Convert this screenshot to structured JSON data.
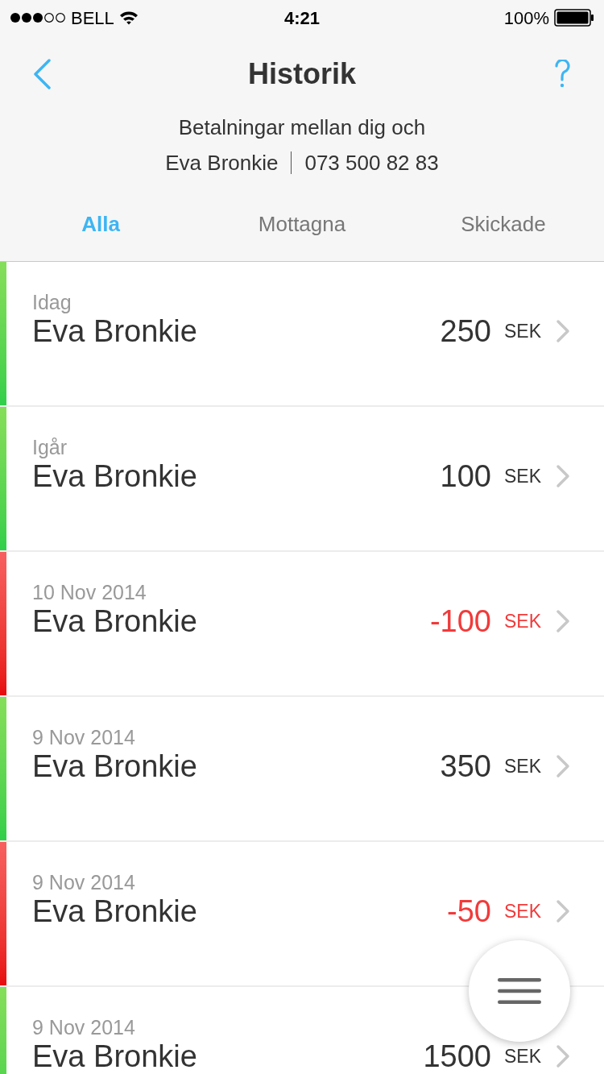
{
  "status_bar": {
    "carrier": "BELL",
    "time": "4:21",
    "battery": "100%"
  },
  "nav": {
    "title": "Historik"
  },
  "header": {
    "subtitle": "Betalningar mellan dig och",
    "contact_name": "Eva Bronkie",
    "contact_phone": "073 500 82 83"
  },
  "tabs": [
    {
      "label": "Alla",
      "selected": true
    },
    {
      "label": "Mottagna",
      "selected": false
    },
    {
      "label": "Skickade",
      "selected": false
    }
  ],
  "transactions": [
    {
      "date": "Idag",
      "name": "Eva Bronkie",
      "amount": "250",
      "currency": "SEK",
      "kind": "received"
    },
    {
      "date": "Igår",
      "name": "Eva Bronkie",
      "amount": "100",
      "currency": "SEK",
      "kind": "received"
    },
    {
      "date": "10 Nov 2014",
      "name": "Eva Bronkie",
      "amount": "-100",
      "currency": "SEK",
      "kind": "sent"
    },
    {
      "date": "9 Nov 2014",
      "name": "Eva Bronkie",
      "amount": "350",
      "currency": "SEK",
      "kind": "received"
    },
    {
      "date": "9 Nov 2014",
      "name": "Eva Bronkie",
      "amount": "-50",
      "currency": "SEK",
      "kind": "sent"
    },
    {
      "date": "9 Nov 2014",
      "name": "Eva Bronkie",
      "amount": "1500",
      "currency": "SEK",
      "kind": "received"
    }
  ]
}
